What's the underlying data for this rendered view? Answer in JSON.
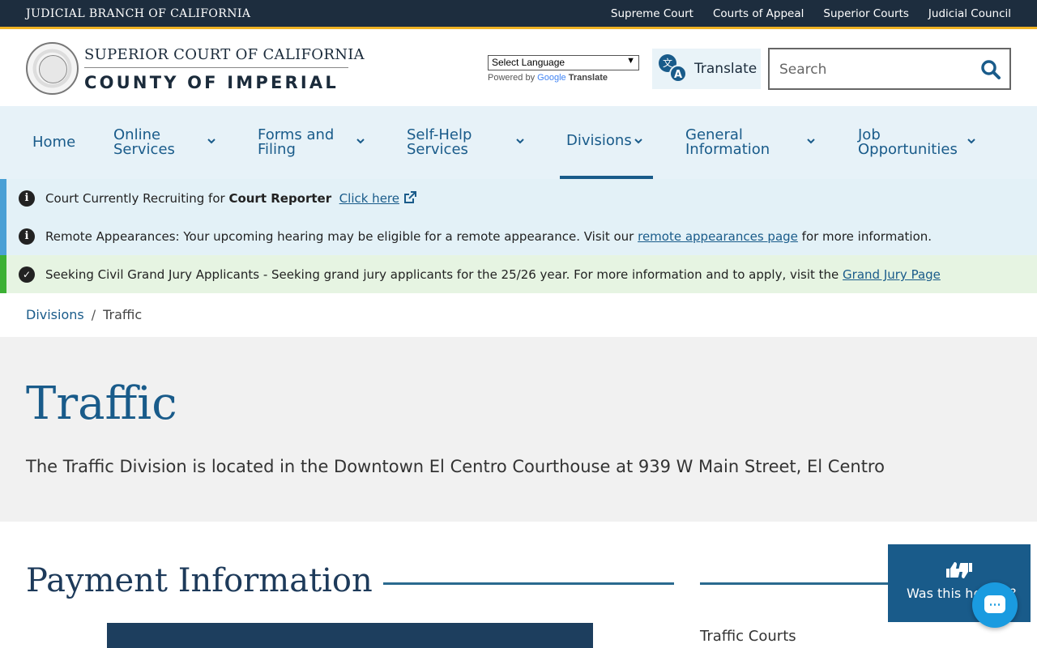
{
  "topbar": {
    "brand": "JUDICIAL BRANCH OF CALIFORNIA",
    "links": [
      "Supreme Court",
      "Courts of Appeal",
      "Superior Courts",
      "Judicial Council"
    ]
  },
  "header": {
    "logo_top": "SUPERIOR COURT OF CALIFORNIA",
    "logo_bottom": "COUNTY OF IMPERIAL",
    "language_select": "Select Language",
    "powered_by": "Powered by",
    "google": "Google",
    "translate_word": "Translate",
    "translate_button": "Translate",
    "search_placeholder": "Search"
  },
  "nav": {
    "items": [
      {
        "label": "Home"
      },
      {
        "label": "Online Services"
      },
      {
        "label": "Forms and Filing"
      },
      {
        "label": "Self-Help Services"
      },
      {
        "label": "Divisions"
      },
      {
        "label": "General Information"
      },
      {
        "label": "Job Opportunities"
      }
    ]
  },
  "alerts": [
    {
      "prefix": "Court Currently Recruiting for ",
      "bold": "Court Reporter",
      "link": "Click here"
    },
    {
      "prefix": "Remote Appearances: Your upcoming hearing may be eligible for a remote appearance. Visit our ",
      "link": "remote appearances page",
      "suffix": " for more information."
    },
    {
      "prefix": "Seeking Civil Grand Jury Applicants",
      "middle": " - Seeking grand jury applicants for the 25/26 year. For more information and to apply, visit the ",
      "link": "Grand Jury Page"
    }
  ],
  "breadcrumb": {
    "parent": "Divisions",
    "separator": "/",
    "current": "Traffic"
  },
  "hero": {
    "title": "Traffic",
    "description": "The Traffic Division is located in the Downtown El Centro Courthouse at 939 W Main Street, El Centro"
  },
  "main": {
    "section_title": "Payment Information",
    "side_link": "Traffic Courts"
  },
  "feedback": {
    "label": "Was this helpful?"
  },
  "colors": {
    "primary": "#195b8a",
    "topbar": "#1d2d3e",
    "accent": "#f0b323",
    "info_bg": "#e3f1f7",
    "success_bg": "#e6f4e2"
  }
}
